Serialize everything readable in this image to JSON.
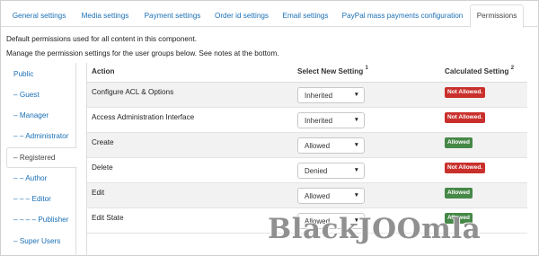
{
  "tabs": [
    {
      "label": "General settings"
    },
    {
      "label": "Media settings"
    },
    {
      "label": "Payment settings"
    },
    {
      "label": "Order id settings"
    },
    {
      "label": "Email settings"
    },
    {
      "label": "PayPal mass payments configuration"
    },
    {
      "label": "Permissions",
      "active": true
    }
  ],
  "intro": {
    "line1": "Default permissions used for all content in this component.",
    "line2": "Manage the permission settings for the user groups below. See notes at the bottom."
  },
  "groups": [
    {
      "label": "Public"
    },
    {
      "label": "– Guest"
    },
    {
      "label": "– Manager"
    },
    {
      "label": "– – Administrator"
    },
    {
      "label": "– Registered",
      "active": true
    },
    {
      "label": "– – Author"
    },
    {
      "label": "– – – Editor"
    },
    {
      "label": "– – – – Publisher"
    },
    {
      "label": "– Super Users"
    }
  ],
  "table": {
    "headers": {
      "action": "Action",
      "new_setting": "Select New Setting",
      "new_setting_note": "1",
      "calculated": "Calculated Setting",
      "calculated_note": "2"
    },
    "rows": [
      {
        "action": "Configure ACL & Options",
        "setting": "Inherited",
        "calculated": "Not Allowed."
      },
      {
        "action": "Access Administration Interface",
        "setting": "Inherited",
        "calculated": "Not Allowed."
      },
      {
        "action": "Create",
        "setting": "Allowed",
        "calculated": "Allowed"
      },
      {
        "action": "Delete",
        "setting": "Denied",
        "calculated": "Not Allowed."
      },
      {
        "action": "Edit",
        "setting": "Allowed",
        "calculated": "Allowed"
      },
      {
        "action": "Edit State",
        "setting": "Allowed",
        "calculated": "Allowed"
      }
    ]
  },
  "colors": {
    "link": "#1a6fb5",
    "not_allowed": "#c9302c",
    "allowed": "#468847"
  },
  "icons": {
    "select_caret": "caret-down-icon"
  },
  "watermark": "BlackJOOmla"
}
